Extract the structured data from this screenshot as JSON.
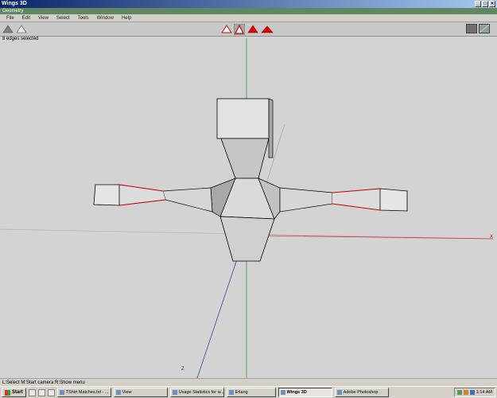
{
  "window": {
    "title": "Wings 3D"
  },
  "geometry_bar": {
    "label": "Geometry"
  },
  "menu": {
    "items": [
      "File",
      "Edit",
      "View",
      "Select",
      "Tools",
      "Window",
      "Help"
    ]
  },
  "selection_info": "8 edges selected",
  "viewport": {
    "axis_z_label": "Z",
    "axis_x_label": "X"
  },
  "status_bar": {
    "text": "L:Select  M:Start camera  R:Show menu"
  },
  "taskbar": {
    "start_label": "Start",
    "tasks": [
      "TShirt Matches.txt - ...",
      "View",
      "Usage Statistics for w...",
      "Erlang",
      "Wings 3D",
      "Adobe Photoshop"
    ],
    "active_index": 4,
    "clock": "1:14 AM"
  }
}
